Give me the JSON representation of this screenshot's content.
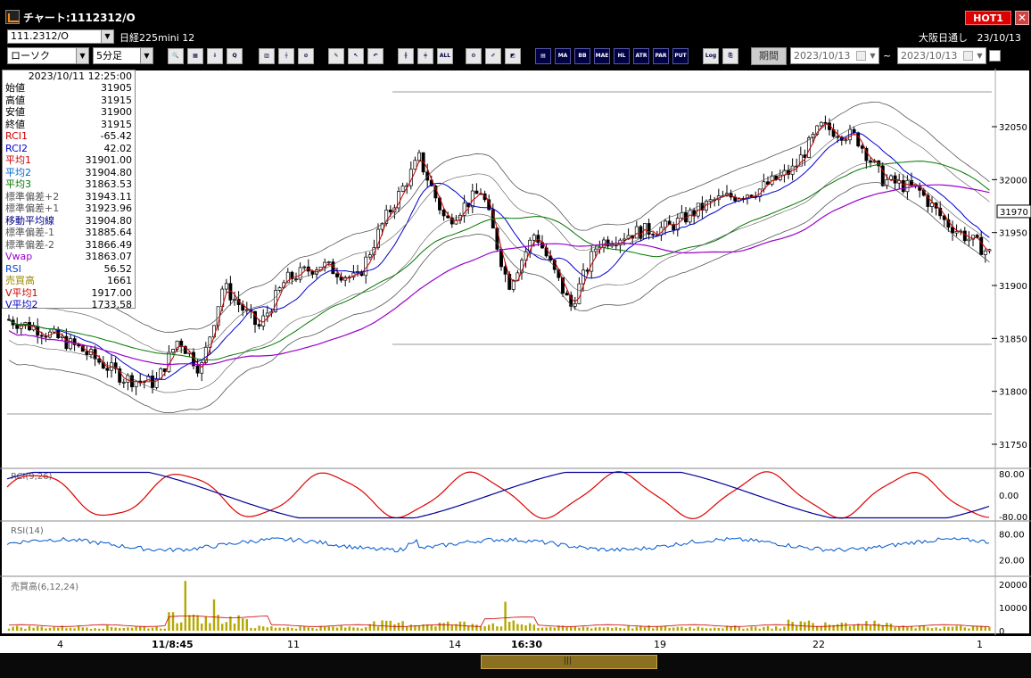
{
  "window": {
    "title": "チャート:1112312/O",
    "hot_label": "HOT1",
    "close_label": "✕"
  },
  "symbol_bar": {
    "symbol_value": "111.2312/O",
    "symbol_name": "日経225mini 12",
    "market_label": "大阪日通し",
    "market_date": "23/10/13"
  },
  "toolbar": {
    "chart_type": "ローソク",
    "interval": "5分足",
    "buttons": [
      {
        "name": "search-icon",
        "label": "🔍"
      },
      {
        "name": "grid-icon",
        "label": "▦"
      },
      {
        "name": "download-icon",
        "label": "⇩"
      },
      {
        "name": "zoom-icon",
        "label": "Q"
      },
      {
        "name": "price-bar-icon",
        "label": "▥"
      },
      {
        "name": "candle-icon",
        "label": "┼"
      },
      {
        "name": "clear-icon",
        "label": "⊘"
      },
      {
        "name": "pen-icon",
        "label": "✎"
      },
      {
        "name": "pointer-icon",
        "label": "↖"
      },
      {
        "name": "undo-icon",
        "label": "↶"
      },
      {
        "name": "candle-split-icon",
        "label": "╫"
      },
      {
        "name": "candle-join-icon",
        "label": "╪"
      },
      {
        "name": "all-icon",
        "label": "ALL"
      },
      {
        "name": "settings-icon",
        "label": "⚙"
      },
      {
        "name": "brush-icon",
        "label": "✐"
      },
      {
        "name": "palette-icon",
        "label": "◩"
      },
      {
        "name": "indicator-icon",
        "label": "▤"
      },
      {
        "name": "ma-icon",
        "label": "MA"
      },
      {
        "name": "bb-icon",
        "label": "BB"
      },
      {
        "name": "mae-icon",
        "label": "MAE"
      },
      {
        "name": "hl-icon",
        "label": "HL"
      },
      {
        "name": "atr-icon",
        "label": "ATR"
      },
      {
        "name": "para-icon",
        "label": "PAR"
      },
      {
        "name": "put-icon",
        "label": "PUT"
      },
      {
        "name": "log-icon",
        "label": "Log"
      },
      {
        "name": "export-icon",
        "label": "⎘"
      }
    ],
    "period_label": "期間",
    "date_from": "2023/10/13",
    "date_to": "2023/10/13",
    "tilde": "~"
  },
  "info_panel": {
    "timestamp": "2023/10/11  12:25:00",
    "rows": [
      {
        "label": "始値",
        "value": "31905",
        "color": "#000000"
      },
      {
        "label": "高値",
        "value": "31915",
        "color": "#000000"
      },
      {
        "label": "安値",
        "value": "31900",
        "color": "#000000"
      },
      {
        "label": "終値",
        "value": "31915",
        "color": "#000000"
      },
      {
        "label": "RCI1",
        "value": "-65.42",
        "color": "#cc0000"
      },
      {
        "label": "RCI2",
        "value": "42.02",
        "color": "#0000cc"
      },
      {
        "label": "平均1",
        "value": "31901.00",
        "color": "#cc0000"
      },
      {
        "label": "平均2",
        "value": "31904.80",
        "color": "#0066cc"
      },
      {
        "label": "平均3",
        "value": "31863.53",
        "color": "#007700"
      },
      {
        "label": "標準偏差+2",
        "value": "31943.11",
        "color": "#555555"
      },
      {
        "label": "標準偏差+1",
        "value": "31923.96",
        "color": "#555555"
      },
      {
        "label": "移動平均線",
        "value": "31904.80",
        "color": "#000088"
      },
      {
        "label": "標準偏差-1",
        "value": "31885.64",
        "color": "#555555"
      },
      {
        "label": "標準偏差-2",
        "value": "31866.49",
        "color": "#555555"
      },
      {
        "label": "Vwap",
        "value": "31863.07",
        "color": "#9900cc"
      },
      {
        "label": "RSI",
        "value": "56.52",
        "color": "#0044cc"
      },
      {
        "label": "売買高",
        "value": "1661",
        "color": "#998800"
      },
      {
        "label": "V平均1",
        "value": "1917.00",
        "color": "#cc0000"
      },
      {
        "label": "V平均2",
        "value": "1733.58",
        "color": "#0000cc"
      }
    ]
  },
  "price_axis": {
    "ticks": [
      "32050",
      "32000",
      "31950",
      "31900",
      "31850",
      "31800",
      "31750"
    ],
    "current_price": "31970"
  },
  "sub_panels": {
    "rci": {
      "label": "RCI(9,26)",
      "ticks": [
        "80.00",
        "0.00",
        "-80.00"
      ]
    },
    "rsi": {
      "label": "RSI(14)",
      "ticks": [
        "80.00",
        "20.00"
      ]
    },
    "volume": {
      "label": "売買高(6,12,24)",
      "ticks": [
        "20000",
        "10000",
        "0"
      ]
    }
  },
  "x_axis": {
    "labels": [
      {
        "text": "4",
        "bold": false
      },
      {
        "text": "11/8:45",
        "bold": true
      },
      {
        "text": "11",
        "bold": false
      },
      {
        "text": "14",
        "bold": false
      },
      {
        "text": "16:30",
        "bold": true
      },
      {
        "text": "19",
        "bold": false
      },
      {
        "text": "22",
        "bold": false
      },
      {
        "text": "1",
        "bold": false
      }
    ]
  },
  "colors": {
    "up_candle": "#ffffff",
    "down_candle": "#000000",
    "ma1": "#cc0000",
    "ma2": "#0000cc",
    "ma3": "#007700",
    "bollinger": "#555555",
    "vwap": "#9900cc",
    "rci_fast": "#dd0000",
    "rci_slow": "#000099",
    "rsi": "#0055cc",
    "volume": "#b5a800"
  }
}
